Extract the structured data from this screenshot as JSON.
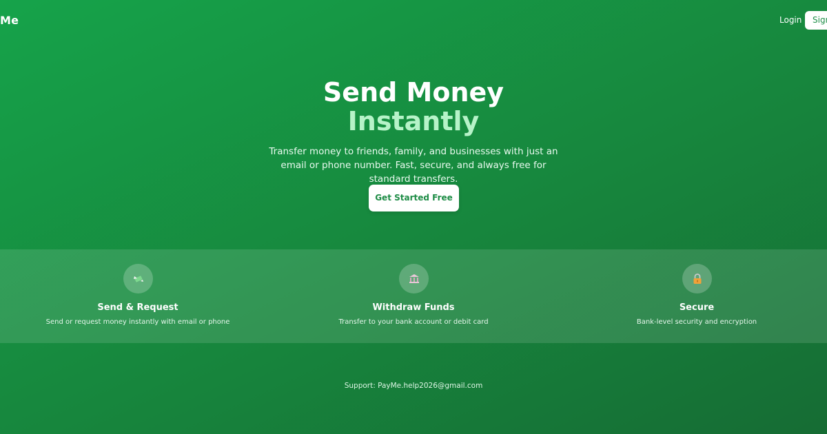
{
  "nav": {
    "logo": "Me",
    "login_label": "Login",
    "signup_label": "Sign"
  },
  "hero": {
    "title_line1": "Send Money",
    "title_line2": "Instantly",
    "subtitle": "Transfer money to friends, family, and businesses with just an email or phone number. Fast, secure, and always free for standard transfers.",
    "cta_label": "Get Started Free"
  },
  "features": [
    {
      "icon": "money-wings-icon",
      "title": "Send & Request",
      "description": "Send or request money instantly with email or phone"
    },
    {
      "icon": "bank-icon",
      "title": "Withdraw Funds",
      "description": "Transfer to your bank account or debit card"
    },
    {
      "icon": "lock-icon",
      "title": "Secure",
      "description": "Bank-level security and encryption"
    }
  ],
  "footer": {
    "support_text": "Support: PayMe.help2026@gmail.com"
  },
  "colors": {
    "brand_green": "#16a34a",
    "accent_text": "#b6f3c8",
    "button_text": "#1d8c45"
  }
}
